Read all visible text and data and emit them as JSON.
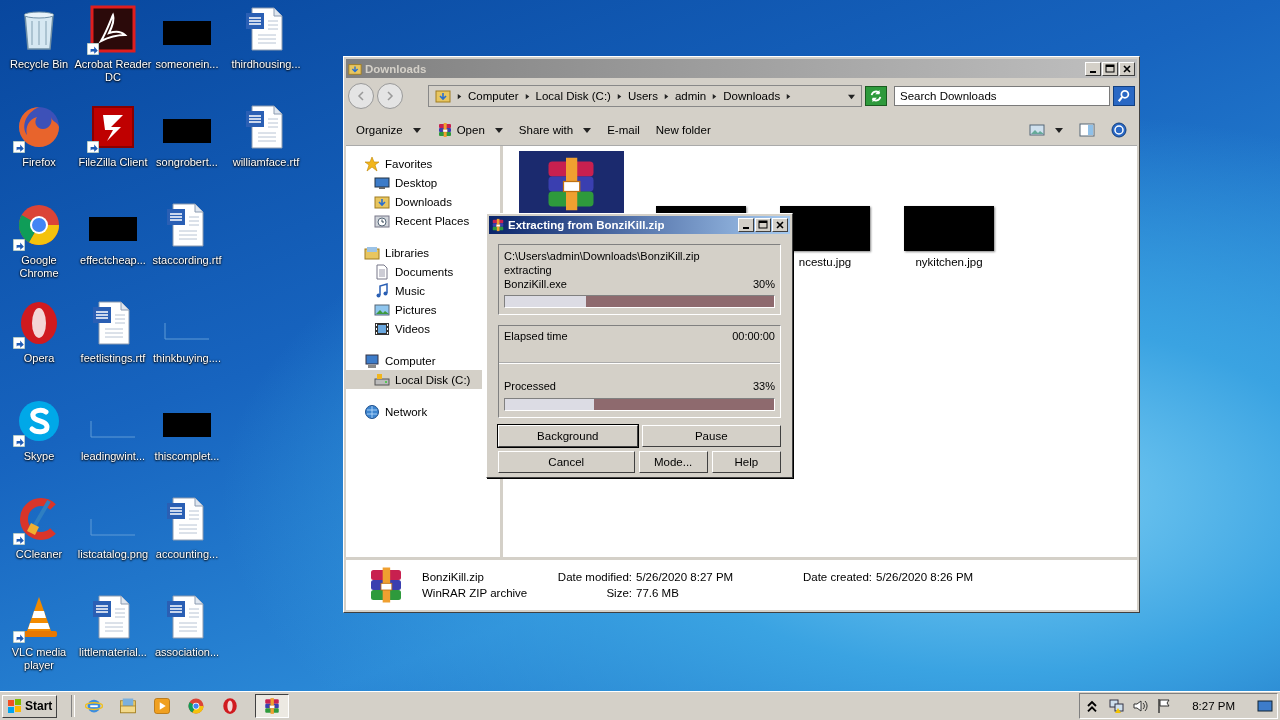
{
  "desktop": {
    "columns": [
      [
        {
          "label": "Recycle Bin",
          "kind": "recycle",
          "shortcut": false
        },
        {
          "label": "Firefox",
          "kind": "firefox",
          "shortcut": true
        },
        {
          "label": "Google Chrome",
          "kind": "chrome",
          "shortcut": true
        },
        {
          "label": "Opera",
          "kind": "opera",
          "shortcut": true
        },
        {
          "label": "Skype",
          "kind": "skype",
          "shortcut": true
        },
        {
          "label": "CCleaner",
          "kind": "ccleaner",
          "shortcut": true
        },
        {
          "label": "VLC media player",
          "kind": "vlc",
          "shortcut": true
        }
      ],
      [
        {
          "label": "Acrobat Reader DC",
          "kind": "acrobat",
          "shortcut": true
        },
        {
          "label": "FileZilla Client",
          "kind": "filezilla",
          "shortcut": true
        },
        {
          "label": "effectcheap...",
          "kind": "redacted",
          "shortcut": false
        },
        {
          "label": "feetlistings.rtf",
          "kind": "word",
          "shortcut": false
        },
        {
          "label": "leadingwint...",
          "kind": "blank",
          "shortcut": false
        },
        {
          "label": "listcatalog.png",
          "kind": "blank",
          "shortcut": false
        },
        {
          "label": "littlematerial...",
          "kind": "word",
          "shortcut": false
        }
      ],
      [
        {
          "label": "someonein...",
          "kind": "redacted",
          "shortcut": false
        },
        {
          "label": "songrobert...",
          "kind": "redacted",
          "shortcut": false
        },
        {
          "label": "staccording.rtf",
          "kind": "word",
          "shortcut": false
        },
        {
          "label": "thinkbuying....",
          "kind": "blank",
          "shortcut": false
        },
        {
          "label": "thiscomplet...",
          "kind": "redacted",
          "shortcut": false
        },
        {
          "label": "accounting...",
          "kind": "word",
          "shortcut": false
        },
        {
          "label": "association...",
          "kind": "word",
          "shortcut": false
        }
      ],
      [
        {
          "label": "thirdhousing...",
          "kind": "word",
          "shortcut": false
        },
        {
          "label": "williamface.rtf",
          "kind": "word",
          "shortcut": false
        }
      ]
    ]
  },
  "explorer": {
    "title": "Downloads",
    "breadcrumb": [
      "Computer",
      "Local Disk (C:)",
      "Users",
      "admin",
      "Downloads"
    ],
    "search": {
      "placeholder": "Search Downloads"
    },
    "toolbar": [
      {
        "label": "Organize",
        "kind": "menu"
      },
      {
        "label": "Open",
        "kind": "open"
      },
      {
        "label": "Share with",
        "kind": "menu"
      },
      {
        "label": "E-mail",
        "kind": "plain"
      },
      {
        "label": "New folder",
        "kind": "plain"
      }
    ],
    "nav": [
      {
        "label": "Favorites",
        "kind": "star",
        "selected": false,
        "children": [
          {
            "label": "Desktop",
            "kind": "desktop",
            "selected": false
          },
          {
            "label": "Downloads",
            "kind": "downloads",
            "selected": false
          },
          {
            "label": "Recent Places",
            "kind": "recent",
            "selected": false
          }
        ]
      },
      {
        "label": "Libraries",
        "kind": "library",
        "selected": false,
        "children": [
          {
            "label": "Documents",
            "kind": "documents",
            "selected": false
          },
          {
            "label": "Music",
            "kind": "music",
            "selected": false
          },
          {
            "label": "Pictures",
            "kind": "pictures",
            "selected": false
          },
          {
            "label": "Videos",
            "kind": "videos",
            "selected": false
          }
        ]
      },
      {
        "label": "Computer",
        "kind": "computer",
        "selected": false,
        "children": [
          {
            "label": "Local Disk (C:)",
            "kind": "drive",
            "selected": true
          }
        ]
      },
      {
        "label": "Network",
        "kind": "network",
        "selected": false
      }
    ],
    "files": [
      {
        "kind": "archive"
      },
      {
        "kind": "thumbnail"
      },
      {
        "kind": "thumbnail",
        "name": "ncestu.jpg"
      },
      {
        "kind": "thumbnail",
        "name": "nykitchen.jpg"
      }
    ],
    "details": {
      "name": "BonziKill.zip",
      "type": "WinRAR ZIP archive",
      "fields": [
        {
          "label": "Date modified:",
          "value": "5/26/2020 8:27 PM"
        },
        {
          "label": "Size:",
          "value": "77.6 MB"
        },
        {
          "label": "Date created:",
          "value": "5/26/2020 8:26 PM"
        }
      ]
    }
  },
  "dialog": {
    "title": "Extracting from BonziKill.zip",
    "path": "C:\\Users\\admin\\Downloads\\BonziKill.zip",
    "action": "extracting",
    "file": "BonziKill.exe",
    "file_percent": "30%",
    "file_progress": {
      "level": 0.3
    },
    "elapsed_label": "Elapsed time",
    "elapsed": "00:00:00",
    "processed_label": "Processed",
    "processed_percent": "33%",
    "processed_progress": {
      "level": 0.33
    },
    "buttons": [
      [
        {
          "label": "Background",
          "default": true
        },
        {
          "label": "Pause",
          "default": false
        }
      ],
      [
        {
          "label": "Cancel",
          "default": false
        },
        {
          "label": "Mode...",
          "default": false
        },
        {
          "label": "Help",
          "default": false
        }
      ]
    ]
  },
  "taskbar": {
    "start": "Start",
    "apps": [
      {
        "kind": "ie",
        "active": false
      },
      {
        "kind": "folder",
        "active": false
      },
      {
        "kind": "media",
        "active": false
      },
      {
        "kind": "chrome",
        "active": false
      },
      {
        "kind": "opera",
        "active": false
      },
      {
        "kind": "winrar",
        "active": true
      }
    ],
    "time": "8:27 PM"
  }
}
